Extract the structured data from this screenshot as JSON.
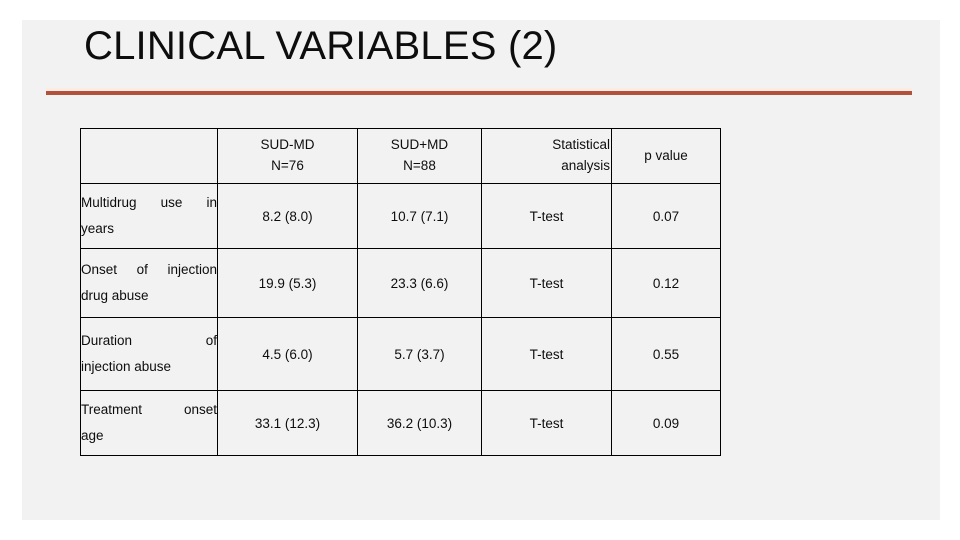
{
  "slide": {
    "title": "CLINICAL VARIABLES (2)",
    "accent_color": "#b0523c",
    "accent_light_color": "#fdece4",
    "background_color": "#f2f2f2",
    "text_color": "#0d0d0d"
  },
  "table": {
    "header": {
      "blank": "",
      "col2_line1": "SUD-MD",
      "col2_line2": "N=76",
      "col3_line1": "SUD+MD",
      "col3_line2": "N=88",
      "col4_line1": "Statistical",
      "col4_line2": "analysis",
      "col5": "p value"
    },
    "rows": [
      {
        "label_line1": "Multidrug use in",
        "label_line2": "years",
        "sud_minus_md": "8.2 (8.0)",
        "sud_plus_md": "10.7 (7.1)",
        "statistical_analysis": "T-test",
        "p_value": "0.07"
      },
      {
        "label_line1": "Onset of injection",
        "label_line2": "drug abuse",
        "sud_minus_md": "19.9 (5.3)",
        "sud_plus_md": "23.3 (6.6)",
        "statistical_analysis": "T-test",
        "p_value": "0.12"
      },
      {
        "label_line1": "Duration of",
        "label_line2": "injection abuse",
        "sud_minus_md": "4.5 (6.0)",
        "sud_plus_md": "5.7 (3.7)",
        "statistical_analysis": "T-test",
        "p_value": "0.55"
      },
      {
        "label_line1": "Treatment onset",
        "label_line2": "age",
        "sud_minus_md": "33.1 (12.3)",
        "sud_plus_md": "36.2 (10.3)",
        "statistical_analysis": "T-test",
        "p_value": "0.09"
      }
    ]
  }
}
